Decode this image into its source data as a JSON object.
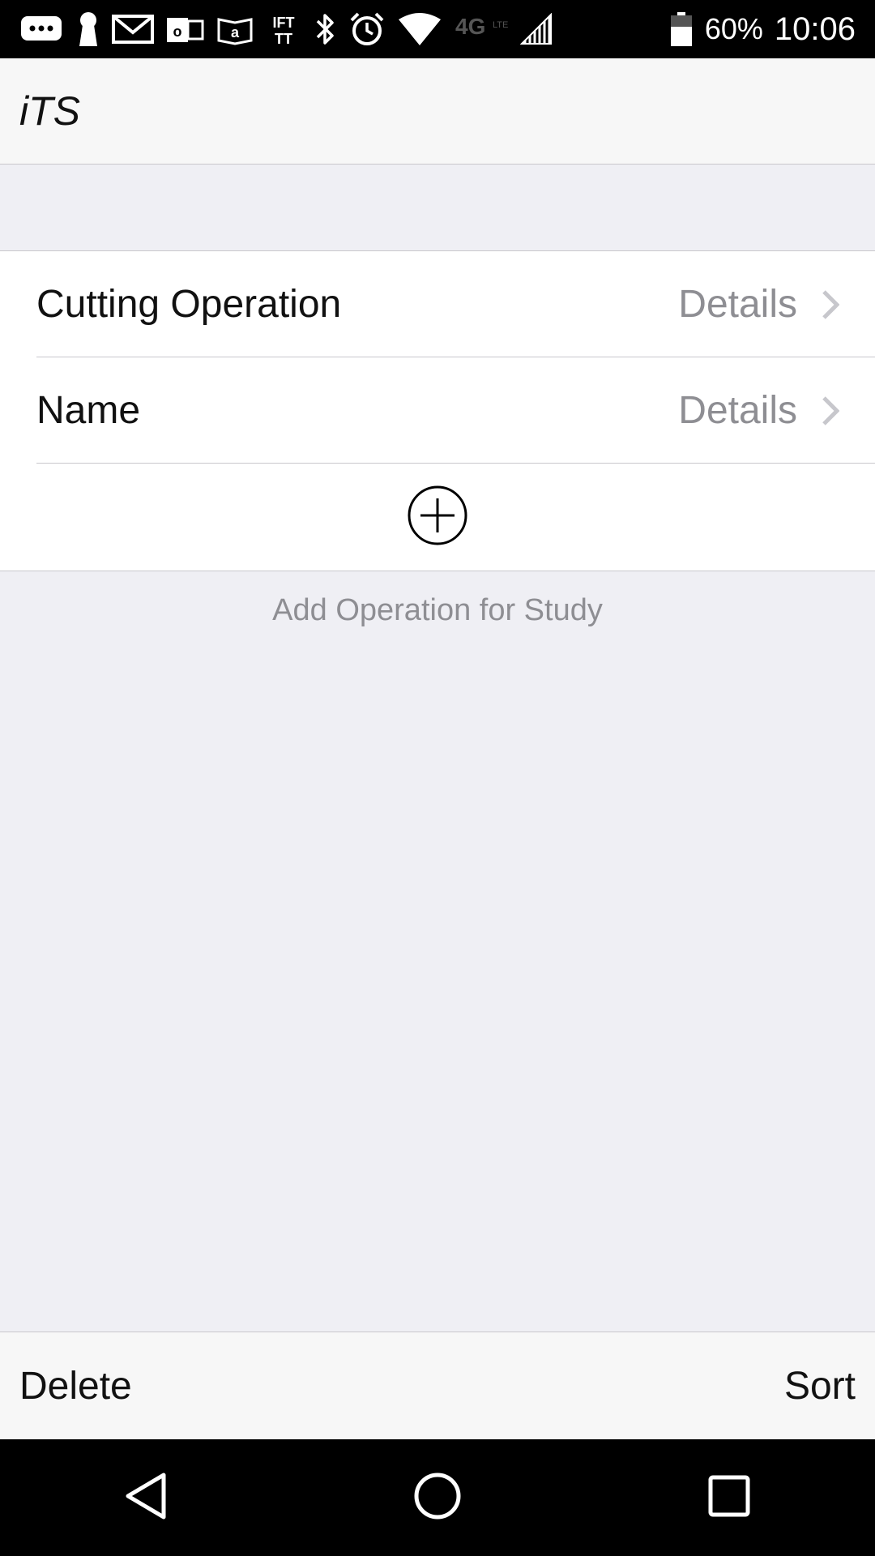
{
  "status_bar": {
    "battery_percent": "60%",
    "time": "10:06",
    "network": "4G",
    "icons": [
      "messages-icon",
      "keyhole-icon",
      "gmail-icon",
      "outlook-icon",
      "amazon-kindle-icon",
      "ifttt-icon",
      "bluetooth-icon",
      "alarm-icon",
      "wifi-icon",
      "lte-icon",
      "signal-icon",
      "battery-icon"
    ]
  },
  "header": {
    "title": "iTS"
  },
  "table": {
    "rows": [
      {
        "title": "Cutting Operation",
        "detail": "Details"
      },
      {
        "title": "Name",
        "detail": "Details"
      }
    ],
    "add_icon": "plus-circle-icon",
    "footer": "Add Operation for Study"
  },
  "toolbar": {
    "left_label": "Delete",
    "right_label": "Sort"
  },
  "nav_bar": {
    "icons": [
      "back-icon",
      "home-icon",
      "recents-icon"
    ]
  },
  "colors": {
    "background": "#efeff4",
    "cell_background": "#ffffff",
    "detail_text": "#8e8e93",
    "separator": "#c8c7cc",
    "bar_background": "#f7f7f7"
  }
}
